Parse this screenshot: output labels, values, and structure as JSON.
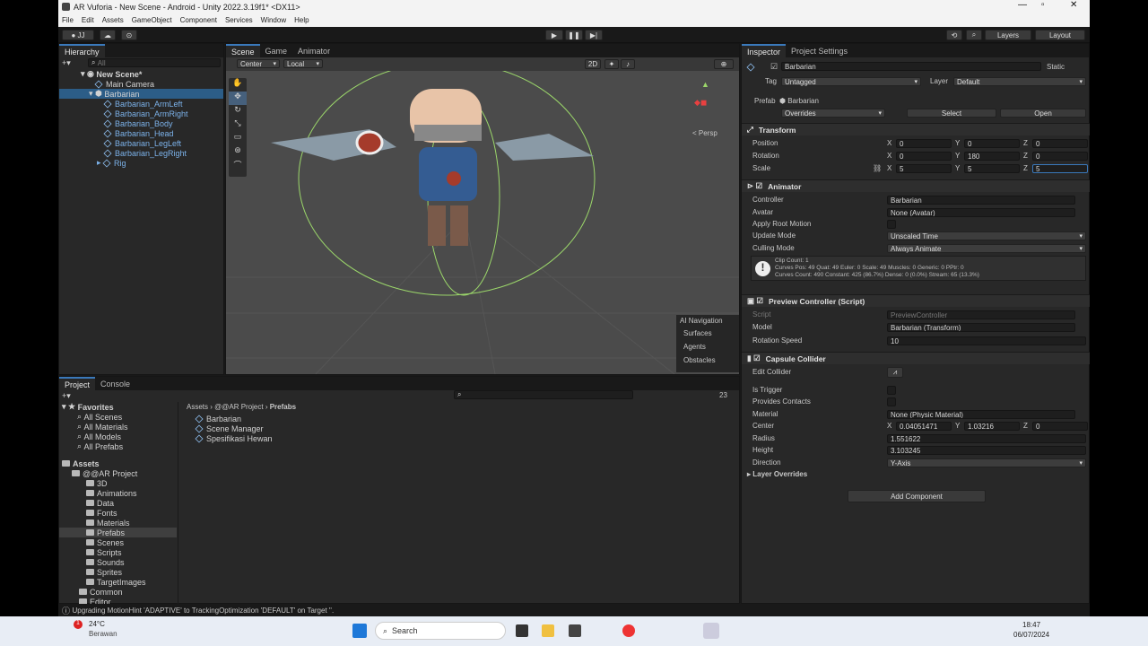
{
  "window": {
    "title": "AR Vuforia - New Scene - Android - Unity 2022.3.19f1* <DX11>"
  },
  "menu": [
    "File",
    "Edit",
    "Assets",
    "GameObject",
    "Component",
    "Services",
    "Window",
    "Help"
  ],
  "toolbar": {
    "account": "JJ",
    "layers": "Layers",
    "layout": "Layout"
  },
  "hierarchy": {
    "tab": "Hierarchy",
    "search_placeholder": "All",
    "scene": "New Scene*",
    "items": [
      "Main Camera",
      "Barbarian",
      "Barbarian_ArmLeft",
      "Barbarian_ArmRight",
      "Barbarian_Body",
      "Barbarian_Head",
      "Barbarian_LegLeft",
      "Barbarian_LegRight",
      "Rig"
    ]
  },
  "scene": {
    "tabs": [
      "Scene",
      "Game",
      "Animator"
    ],
    "pivot": "Center",
    "space": "Local",
    "mode2d": "2D",
    "persp": "< Persp",
    "overlay": {
      "title": "AI Navigation",
      "items": [
        "Surfaces",
        "Agents",
        "Obstacles"
      ]
    }
  },
  "project": {
    "tabs": [
      "Project",
      "Console"
    ],
    "count": "23",
    "favorites_label": "Favorites",
    "favorites": [
      "All Scenes",
      "All Materials",
      "All Models",
      "All Prefabs"
    ],
    "assets_label": "Assets",
    "project_root": "@@AR Project",
    "folders": [
      "3D",
      "Animations",
      "Data",
      "Fonts",
      "Materials",
      "Prefabs",
      "Scenes",
      "Scripts",
      "Sounds",
      "Sprites",
      "TargetImages"
    ],
    "more": [
      "Common",
      "Editor"
    ],
    "breadcrumb": [
      "Assets",
      "@@AR Project",
      "Prefabs"
    ],
    "files": [
      "Barbarian",
      "Scene Manager",
      "Spesifikasi Hewan"
    ]
  },
  "inspector": {
    "tabs": [
      "Inspector",
      "Project Settings"
    ],
    "name": "Barbarian",
    "static": "Static",
    "tag_label": "Tag",
    "tag": "Untagged",
    "layer_label": "Layer",
    "layer": "Default",
    "prefab_label": "Prefab",
    "prefab": "Barbarian",
    "overrides": "Overrides",
    "select": "Select",
    "open": "Open",
    "transform": {
      "title": "Transform",
      "position_label": "Position",
      "rotation_label": "Rotation",
      "scale_label": "Scale",
      "position": [
        "0",
        "0",
        "0"
      ],
      "rotation": [
        "0",
        "180",
        "0"
      ],
      "scale": [
        "5",
        "5",
        "5"
      ]
    },
    "animator": {
      "title": "Animator",
      "controller_label": "Controller",
      "controller": "Barbarian",
      "avatar_label": "Avatar",
      "avatar": "None (Avatar)",
      "root_motion_label": "Apply Root Motion",
      "update_label": "Update Mode",
      "update": "Unscaled Time",
      "culling_label": "Culling Mode",
      "culling": "Always Animate",
      "info": [
        "Clip Count: 1",
        "Curves Pos: 49 Quat: 49 Euler: 0 Scale: 49 Muscles: 0 Generic: 0 PPtr: 0",
        "Curves Count: 490 Constant: 425 (86.7%) Dense: 0 (0.0%) Stream: 65 (13.3%)"
      ]
    },
    "preview": {
      "title": "Preview Controller (Script)",
      "script_label": "Script",
      "script": "PreviewController",
      "model_label": "Model",
      "model": "Barbarian (Transform)",
      "speed_label": "Rotation Speed",
      "speed": "10"
    },
    "collider": {
      "title": "Capsule Collider",
      "edit_label": "Edit Collider",
      "trigger_label": "Is Trigger",
      "contacts_label": "Provides Contacts",
      "material_label": "Material",
      "material": "None (Physic Material)",
      "center_label": "Center",
      "center": [
        "0.04051471",
        "1.03216",
        "0"
      ],
      "radius_label": "Radius",
      "radius": "1.551622",
      "height_label": "Height",
      "height": "3.103245",
      "direction_label": "Direction",
      "direction": "Y-Axis"
    },
    "layer_overrides": "Layer Overrides",
    "add_component": "Add Component"
  },
  "status": "Upgrading MotionHint 'ADAPTIVE' to TrackingOptimization 'DEFAULT' on Target ''.",
  "taskbar": {
    "temp": "24°C",
    "weather": "Berawan",
    "search": "Search",
    "time": "18:47",
    "date": "06/07/2024",
    "badge": "1"
  }
}
